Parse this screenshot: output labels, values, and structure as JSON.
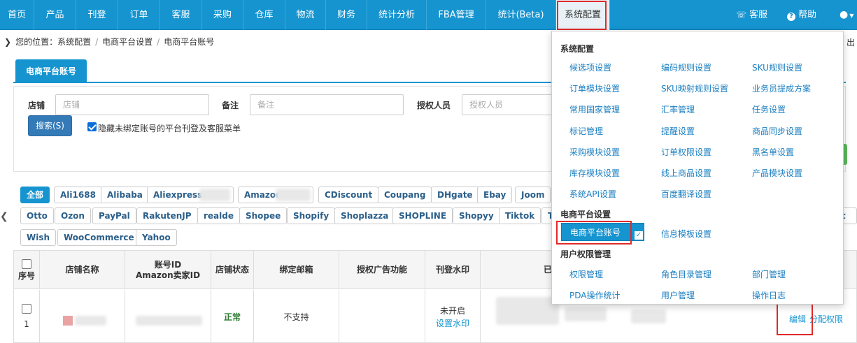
{
  "nav": {
    "items": [
      "首页",
      "产品",
      "刊登",
      "订单",
      "客服",
      "采购",
      "仓库",
      "物流",
      "财务",
      "统计分析",
      "FBA管理",
      "统计(Beta)",
      "系统配置"
    ],
    "service": "客服",
    "help": "帮助"
  },
  "breadcrumb": {
    "prefix": "您的位置：",
    "items": [
      "系统配置",
      "电商平台设置",
      "电商平台账号"
    ]
  },
  "tab": "电商平台账号",
  "filter": {
    "shop_label": "店铺",
    "shop_placeholder": "店铺",
    "note_label": "备注",
    "note_placeholder": "备注",
    "auth_label": "授权人员",
    "auth_placeholder": "授权人员",
    "search_button": "搜索(S)",
    "hide_checkbox": "隐藏未绑定账号的平台刊登及客服菜单"
  },
  "platforms_row1": [
    "全部",
    "Ali1688",
    "Alibaba",
    "Aliexpress",
    "Amazon",
    "CDiscount",
    "Coupang",
    "DHgate",
    "Ebay",
    "Joom"
  ],
  "platforms_row2": [
    "Otto",
    "Ozon",
    "PayPal",
    "RakutenJP",
    "realde",
    "Shopee",
    "Shopify",
    "Shoplazza",
    "SHOPLINE",
    "Shopyy",
    "Tiktok",
    "T"
  ],
  "platforms_row3": [
    "Wish",
    "WooCommerce",
    "Yahoo"
  ],
  "table": {
    "headers": {
      "index": "序号",
      "shop_name": "店铺名称",
      "account_id": "账号ID",
      "amazon_seller_id": "Amazon卖家ID",
      "shop_status": "店铺状态",
      "bind_email": "绑定邮箱",
      "ad_auth": "授权广告功能",
      "watermark": "刊登水印",
      "partial": "已授"
    },
    "row": {
      "index": "1",
      "status": "正常",
      "email": "不支持",
      "watermark_status": "未开启",
      "watermark_link": "设置水印",
      "edit": "编辑",
      "assign_permission": "分配权限"
    }
  },
  "dropdown": {
    "sections": [
      {
        "title": "系统配置",
        "items": [
          "候选项设置",
          "编码规则设置",
          "SKU规则设置",
          "订单模块设置",
          "SKU映射规则设置",
          "业务员提成方案",
          "常用国家管理",
          "汇率管理",
          "任务设置",
          "标记管理",
          "提醒设置",
          "商品同步设置",
          "采购模块设置",
          "订单权限设置",
          "黑名单设置",
          "库存模块设置",
          "线上商品设置",
          "产品模块设置",
          "系统API设置",
          "百度翻译设置"
        ]
      },
      {
        "title": "电商平台设置",
        "items": [
          "电商平台账号",
          "信息模板设置"
        ]
      },
      {
        "title": "用户权限管理",
        "items": [
          "权限管理",
          "角色目录管理",
          "部门管理",
          "PDA操作统计",
          "用户管理",
          "操作日志"
        ]
      }
    ]
  },
  "edge_text": {
    "export_fragment": "出",
    "platform_fragment": "rt"
  },
  "colors": {
    "nav_bg": "#1594d0",
    "accent": "#1594d0",
    "highlight_box": "#e02b2b",
    "status_ok": "#2e7d32"
  }
}
